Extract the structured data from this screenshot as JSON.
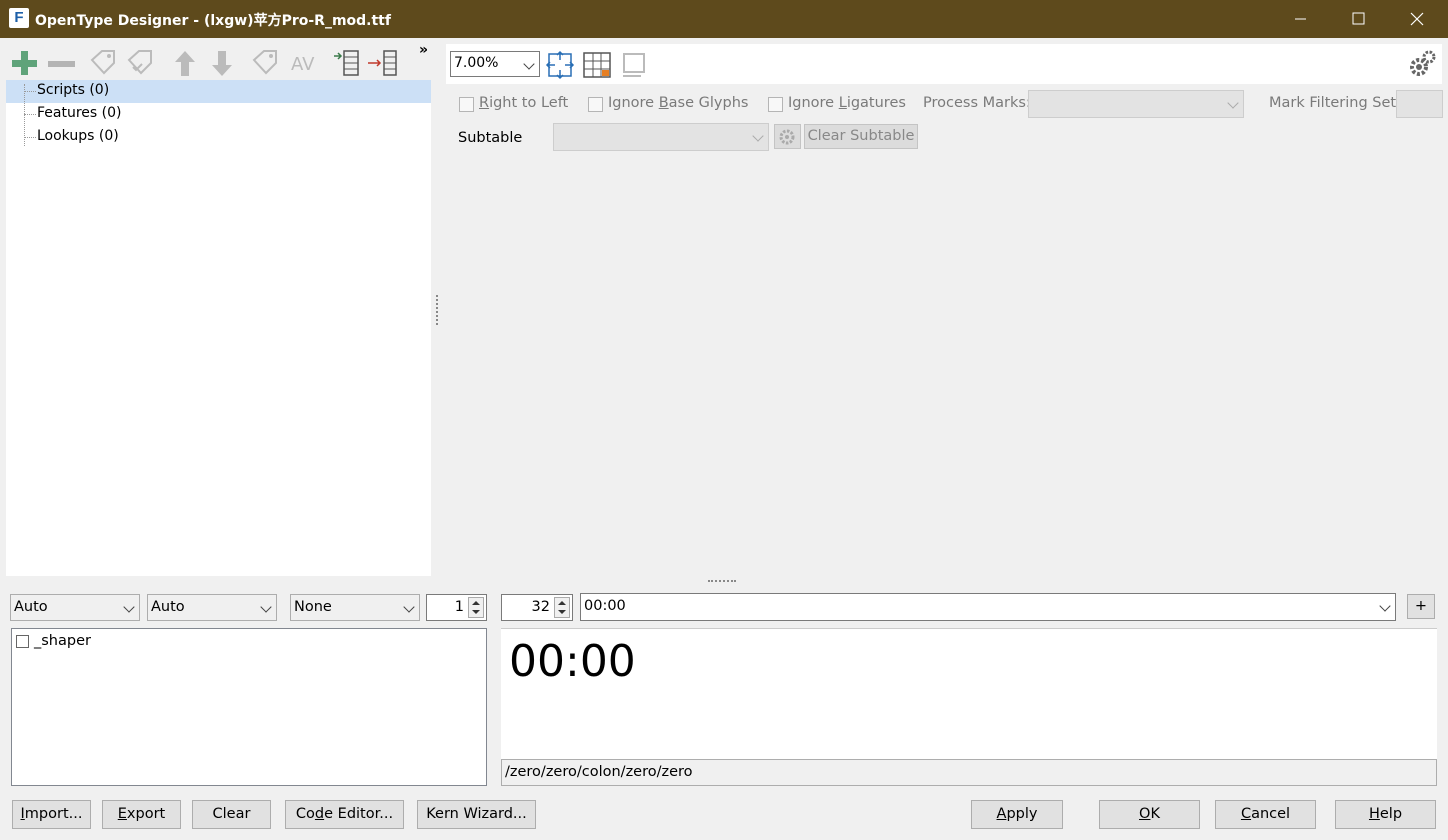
{
  "window": {
    "title": "OpenType Designer - (lxgw)苹方Pro-R_mod.ttf",
    "app_icon_letter": "F",
    "controls": [
      "minimize-icon",
      "maximize-icon",
      "close-icon"
    ]
  },
  "left_toolbar": {
    "overflow_label": "»",
    "icons": [
      "add-icon",
      "remove-icon",
      "tag-icon",
      "tag-check-icon",
      "arrow-up-icon",
      "arrow-down-icon",
      "tag-icon",
      "kerning-icon",
      "import-table-icon",
      "export-table-icon"
    ]
  },
  "tree": {
    "items": [
      {
        "label": "Scripts (0)",
        "selected": true
      },
      {
        "label": "Features (0)",
        "selected": false
      },
      {
        "label": "Lookups (0)",
        "selected": false
      }
    ]
  },
  "right_toolbar": {
    "zoom": "7.00%",
    "icons": [
      "fit-view-icon",
      "glyph-grid-icon",
      "clear-view-icon",
      "settings-gear-icon"
    ]
  },
  "lookup_options": {
    "right_to_left": {
      "prefix": "",
      "mnemonic": "R",
      "rest": "ight to Left"
    },
    "ignore_base_glyphs": {
      "prefix": "Ignore ",
      "mnemonic": "B",
      "rest": "ase Glyphs"
    },
    "ignore_ligatures": {
      "prefix": "Ignore ",
      "mnemonic": "L",
      "rest": "igatures"
    },
    "process_marks_label": "Process Marks:",
    "mark_filtering_label": "Mark Filtering Set:",
    "subtable_label": "Subtable",
    "clear_subtable_label": "Clear Subtable"
  },
  "preview_controls": {
    "script_select": "Auto",
    "language_select": "Auto",
    "direction_select": "None",
    "count_value": "1",
    "font_size_value": "32",
    "preview_text": "00:00",
    "add_button": "+"
  },
  "feature_list": {
    "items": [
      {
        "label": "_shaper",
        "checked": false
      }
    ]
  },
  "preview": {
    "rendered_text": "00:00",
    "glyph_string": "/zero/zero/colon/zero/zero"
  },
  "buttons": {
    "import": {
      "mnemonic": "I",
      "rest": "mport..."
    },
    "export": {
      "mnemonic": "E",
      "rest": "xport"
    },
    "clear": "Clear",
    "code_editor": {
      "prefix": "Co",
      "mnemonic": "d",
      "rest": "e Editor..."
    },
    "kern_wizard": "Kern Wizard...",
    "apply": {
      "mnemonic": "A",
      "rest": "pply"
    },
    "ok": {
      "mnemonic": "O",
      "rest": "K"
    },
    "cancel": {
      "mnemonic": "C",
      "rest": "ancel"
    },
    "help": {
      "mnemonic": "H",
      "rest": "elp"
    }
  }
}
